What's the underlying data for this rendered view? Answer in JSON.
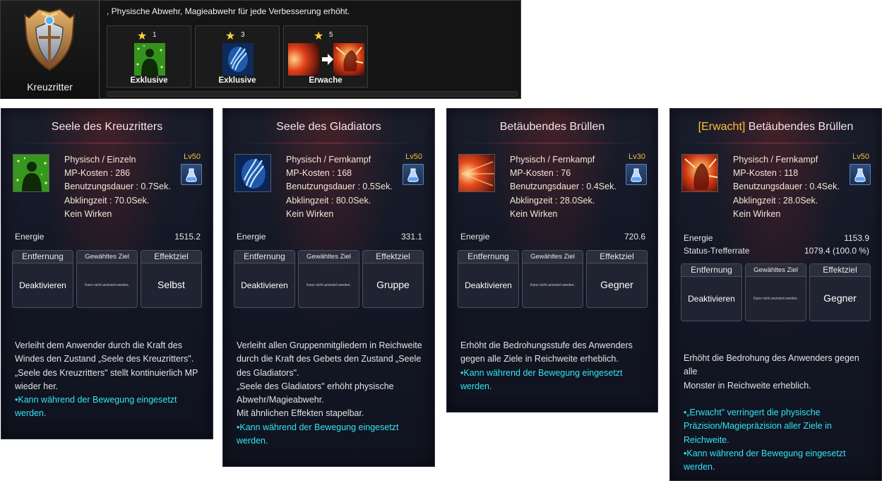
{
  "top_strip": {
    "class_name": "Kreuzritter",
    "description": ", Physische Abwehr, Magieabwehr für jede Verbesserung erhöht.",
    "items": [
      {
        "stars": "1",
        "label": "Exklusive"
      },
      {
        "stars": "3",
        "label": "Exklusive"
      },
      {
        "stars": "5",
        "label": "Erwache"
      }
    ]
  },
  "labels": {
    "energy": "Energie",
    "status_hit": "Status-Trefferrate",
    "range": "Entfernung",
    "chosen_target": "Gewähltes Ziel",
    "effect_target": "Effektziel",
    "deactivate": "Deaktivieren",
    "cannot_target": "Kann nicht anvisiert werden."
  },
  "panels": [
    {
      "title_tag": "",
      "title": "Seele des Kreuzritters",
      "icon": "green-soul-icon",
      "type": "Physisch / Einzeln",
      "mp": "MP-Kosten : 286",
      "duration": "Benutzungsdauer : 0.7Sek.",
      "cooldown": "Abklingzeit : 70.0Sek.",
      "effect": "Kein Wirken",
      "level": "Lv50",
      "energy": "1515.2",
      "effect_target": "Selbst",
      "desc": [
        {
          "text": "Verleiht dem Anwender durch die Kraft des",
          "cyan": false
        },
        {
          "text": "Windes den Zustand „Seele des Kreuzritters\".",
          "cyan": false
        },
        {
          "text": "„Seele des Kreuzritters\" stellt kontinuierlich MP",
          "cyan": false
        },
        {
          "text": "wieder her.",
          "cyan": false
        },
        {
          "text": "•Kann während der Bewegung eingesetzt",
          "cyan": true
        },
        {
          "text": "werden.",
          "cyan": true
        }
      ]
    },
    {
      "title_tag": "",
      "title": "Seele des Gladiators",
      "icon": "blue-soul-icon",
      "type": "Physisch / Fernkampf",
      "mp": "MP-Kosten : 168",
      "duration": "Benutzungsdauer : 0.5Sek.",
      "cooldown": "Abklingzeit : 80.0Sek.",
      "effect": "Kein Wirken",
      "level": "Lv50",
      "energy": "331.1",
      "effect_target": "Gruppe",
      "desc": [
        {
          "text": "Verleiht allen Gruppenmitgliedern in Reichweite",
          "cyan": false
        },
        {
          "text": "durch die Kraft des Gebets den Zustand „Seele",
          "cyan": false
        },
        {
          "text": "des Gladiators\".",
          "cyan": false
        },
        {
          "text": "„Seele des Gladiators\" erhöht physische",
          "cyan": false
        },
        {
          "text": "Abwehr/Magieabwehr.",
          "cyan": false
        },
        {
          "text": "Mit ähnlichen Effekten stapelbar.",
          "cyan": false
        },
        {
          "text": "•Kann während der Bewegung eingesetzt",
          "cyan": true
        },
        {
          "text": "werden.",
          "cyan": true
        }
      ]
    },
    {
      "title_tag": "",
      "title": "Betäubendes Brüllen",
      "icon": "red-roar-icon",
      "type": "Physisch / Fernkampf",
      "mp": "MP-Kosten : 76",
      "duration": "Benutzungsdauer : 0.4Sek.",
      "cooldown": "Abklingzeit : 28.0Sek.",
      "effect": "Kein Wirken",
      "level": "Lv30",
      "energy": "720.6",
      "effect_target": "Gegner",
      "desc": [
        {
          "text": "Erhöht die Bedrohungsstufe des Anwenders",
          "cyan": false
        },
        {
          "text": "gegen alle Ziele in Reichweite erheblich.",
          "cyan": false
        },
        {
          "text": "•Kann während der Bewegung eingesetzt",
          "cyan": true
        },
        {
          "text": "werden.",
          "cyan": true
        }
      ]
    },
    {
      "title_tag": "[Erwacht]",
      "title": " Betäubendes Brüllen",
      "icon": "awakened-roar-icon",
      "type": "Physisch / Fernkampf",
      "mp": "MP-Kosten : 118",
      "duration": "Benutzungsdauer : 0.4Sek.",
      "cooldown": "Abklingzeit : 28.0Sek.",
      "effect": "Kein Wirken",
      "level": "Lv50",
      "energy": "1153.9",
      "status_hit_value": "1079.4 (100.0 %)",
      "effect_target": "Gegner",
      "desc": [
        {
          "text": "Erhöht die Bedrohung des Anwenders gegen alle",
          "cyan": false
        },
        {
          "text": "Monster in Reichweite erheblich.",
          "cyan": false
        },
        {
          "text": "",
          "cyan": false
        },
        {
          "text": "•„Erwacht\" verringert die physische",
          "cyan": true
        },
        {
          "text": "Präzision/Magiepräzision aller Ziele in",
          "cyan": true
        },
        {
          "text": "Reichweite.",
          "cyan": true
        },
        {
          "text": "•Kann während der Bewegung eingesetzt",
          "cyan": true
        },
        {
          "text": "werden.",
          "cyan": true
        }
      ]
    }
  ]
}
